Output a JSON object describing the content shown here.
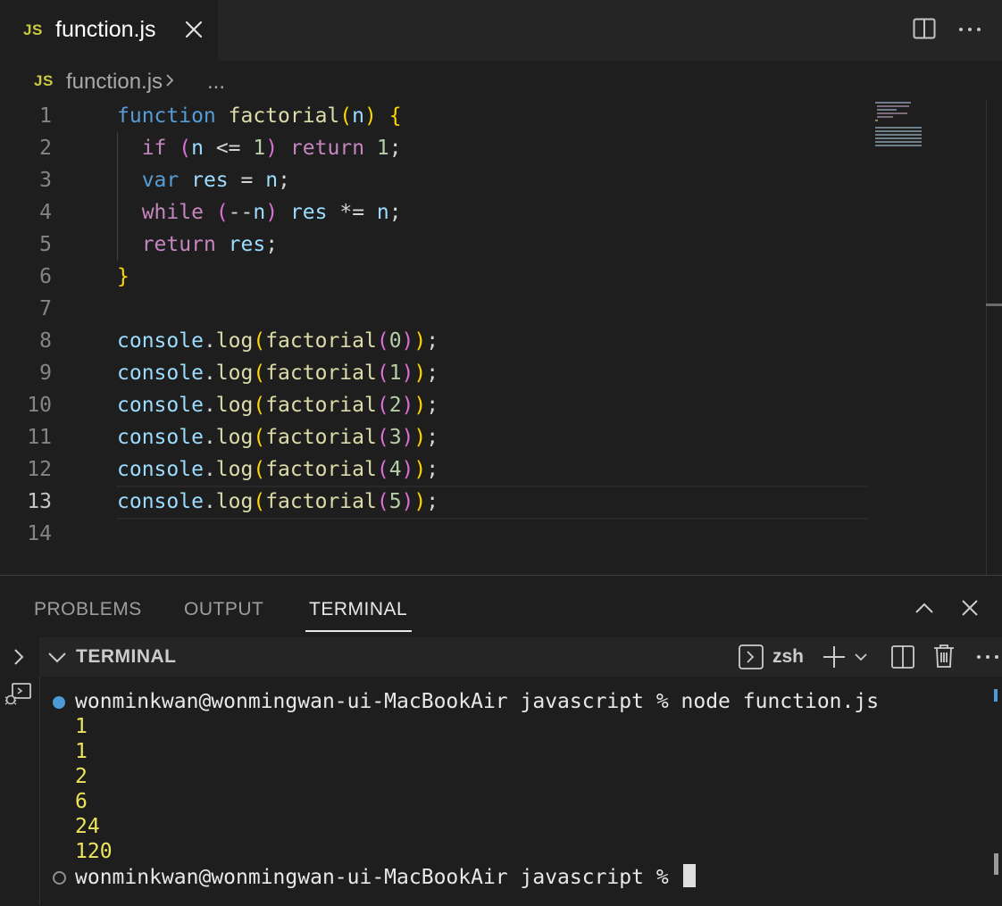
{
  "tab": {
    "badge": "JS",
    "filename": "function.js"
  },
  "breadcrumb": {
    "badge": "JS",
    "file": "function.js",
    "ellipsis": "..."
  },
  "editor": {
    "active_line": 13,
    "lines": [
      {
        "num": "1",
        "tokens": [
          [
            "function",
            "k-fn"
          ],
          [
            " ",
            "k-punc"
          ],
          [
            "factorial",
            "k-name"
          ],
          [
            "(",
            "k-b1"
          ],
          [
            "n",
            "k-var"
          ],
          [
            ")",
            "k-b1"
          ],
          [
            " ",
            "k-punc"
          ],
          [
            "{",
            "k-b1"
          ]
        ]
      },
      {
        "num": "2",
        "tokens": [
          [
            "  ",
            "k-punc"
          ],
          [
            "if",
            "k-ctl"
          ],
          [
            " ",
            "k-punc"
          ],
          [
            "(",
            "k-b2"
          ],
          [
            "n",
            "k-var"
          ],
          [
            " <= ",
            "k-punc"
          ],
          [
            "1",
            "k-num"
          ],
          [
            ")",
            "k-b2"
          ],
          [
            " ",
            "k-punc"
          ],
          [
            "return",
            "k-ctl"
          ],
          [
            " ",
            "k-punc"
          ],
          [
            "1",
            "k-num"
          ],
          [
            ";",
            "k-punc"
          ]
        ]
      },
      {
        "num": "3",
        "tokens": [
          [
            "  ",
            "k-punc"
          ],
          [
            "var",
            "k-fn"
          ],
          [
            " ",
            "k-punc"
          ],
          [
            "res",
            "k-var"
          ],
          [
            " = ",
            "k-punc"
          ],
          [
            "n",
            "k-var"
          ],
          [
            ";",
            "k-punc"
          ]
        ]
      },
      {
        "num": "4",
        "tokens": [
          [
            "  ",
            "k-punc"
          ],
          [
            "while",
            "k-ctl"
          ],
          [
            " ",
            "k-punc"
          ],
          [
            "(",
            "k-b2"
          ],
          [
            "--",
            "k-punc"
          ],
          [
            "n",
            "k-var"
          ],
          [
            ")",
            "k-b2"
          ],
          [
            " ",
            "k-punc"
          ],
          [
            "res",
            "k-var"
          ],
          [
            " *= ",
            "k-punc"
          ],
          [
            "n",
            "k-var"
          ],
          [
            ";",
            "k-punc"
          ]
        ]
      },
      {
        "num": "5",
        "tokens": [
          [
            "  ",
            "k-punc"
          ],
          [
            "return",
            "k-ctl"
          ],
          [
            " ",
            "k-punc"
          ],
          [
            "res",
            "k-var"
          ],
          [
            ";",
            "k-punc"
          ]
        ]
      },
      {
        "num": "6",
        "tokens": [
          [
            "}",
            "k-b1"
          ]
        ]
      },
      {
        "num": "7",
        "tokens": []
      },
      {
        "num": "8",
        "tokens": [
          [
            "console",
            "k-var"
          ],
          [
            ".",
            "k-punc"
          ],
          [
            "log",
            "k-name"
          ],
          [
            "(",
            "k-b1"
          ],
          [
            "factorial",
            "k-name"
          ],
          [
            "(",
            "k-b2"
          ],
          [
            "0",
            "k-num"
          ],
          [
            ")",
            "k-b2"
          ],
          [
            ")",
            "k-b1"
          ],
          [
            ";",
            "k-punc"
          ]
        ]
      },
      {
        "num": "9",
        "tokens": [
          [
            "console",
            "k-var"
          ],
          [
            ".",
            "k-punc"
          ],
          [
            "log",
            "k-name"
          ],
          [
            "(",
            "k-b1"
          ],
          [
            "factorial",
            "k-name"
          ],
          [
            "(",
            "k-b2"
          ],
          [
            "1",
            "k-num"
          ],
          [
            ")",
            "k-b2"
          ],
          [
            ")",
            "k-b1"
          ],
          [
            ";",
            "k-punc"
          ]
        ]
      },
      {
        "num": "10",
        "tokens": [
          [
            "console",
            "k-var"
          ],
          [
            ".",
            "k-punc"
          ],
          [
            "log",
            "k-name"
          ],
          [
            "(",
            "k-b1"
          ],
          [
            "factorial",
            "k-name"
          ],
          [
            "(",
            "k-b2"
          ],
          [
            "2",
            "k-num"
          ],
          [
            ")",
            "k-b2"
          ],
          [
            ")",
            "k-b1"
          ],
          [
            ";",
            "k-punc"
          ]
        ]
      },
      {
        "num": "11",
        "tokens": [
          [
            "console",
            "k-var"
          ],
          [
            ".",
            "k-punc"
          ],
          [
            "log",
            "k-name"
          ],
          [
            "(",
            "k-b1"
          ],
          [
            "factorial",
            "k-name"
          ],
          [
            "(",
            "k-b2"
          ],
          [
            "3",
            "k-num"
          ],
          [
            ")",
            "k-b2"
          ],
          [
            ")",
            "k-b1"
          ],
          [
            ";",
            "k-punc"
          ]
        ]
      },
      {
        "num": "12",
        "tokens": [
          [
            "console",
            "k-var"
          ],
          [
            ".",
            "k-punc"
          ],
          [
            "log",
            "k-name"
          ],
          [
            "(",
            "k-b1"
          ],
          [
            "factorial",
            "k-name"
          ],
          [
            "(",
            "k-b2"
          ],
          [
            "4",
            "k-num"
          ],
          [
            ")",
            "k-b2"
          ],
          [
            ")",
            "k-b1"
          ],
          [
            ";",
            "k-punc"
          ]
        ]
      },
      {
        "num": "13",
        "tokens": [
          [
            "console",
            "k-var"
          ],
          [
            ".",
            "k-punc"
          ],
          [
            "log",
            "k-name"
          ],
          [
            "(",
            "k-b1"
          ],
          [
            "factorial",
            "k-name"
          ],
          [
            "(",
            "k-b2"
          ],
          [
            "5",
            "k-num"
          ],
          [
            ")",
            "k-b2"
          ],
          [
            ")",
            "k-b1"
          ],
          [
            ";",
            "k-punc"
          ]
        ]
      },
      {
        "num": "14",
        "tokens": []
      }
    ]
  },
  "panel": {
    "tabs": [
      "PROBLEMS",
      "OUTPUT",
      "TERMINAL"
    ],
    "active_tab": "TERMINAL",
    "terminal_header": "TERMINAL",
    "shell": "zsh"
  },
  "terminal": {
    "prompt_command": "wonminkwan@wonmingwan-ui-MacBookAir javascript % node function.js",
    "outputs": [
      "1",
      "1",
      "2",
      "6",
      "24",
      "120"
    ],
    "prompt_current": "wonminkwan@wonmingwan-ui-MacBookAir javascript % "
  },
  "icons": [
    "close-icon",
    "split-editor-icon",
    "more-actions-icon",
    "chevron-right-icon",
    "maximize-panel-icon",
    "close-panel-icon",
    "expand-icon",
    "collapse-chevron-icon",
    "launch-profile-icon",
    "add-terminal-icon",
    "dropdown-chevron-icon",
    "split-terminal-icon",
    "trash-icon",
    "debug-console-icon"
  ]
}
